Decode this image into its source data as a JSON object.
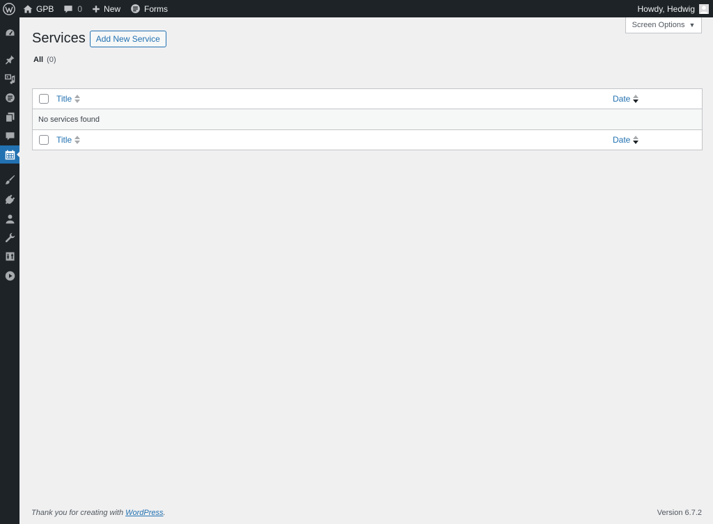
{
  "admin_bar": {
    "site_name": "GPB",
    "comments_count": "0",
    "new_label": "New",
    "forms_label": "Forms",
    "howdy": "Howdy, Hedwig"
  },
  "sidebar": {
    "items": [
      {
        "icon": "dashboard-icon"
      },
      {
        "icon": "posts-pin-icon"
      },
      {
        "icon": "media-icon"
      },
      {
        "icon": "forms-icon"
      },
      {
        "icon": "pages-icon"
      },
      {
        "icon": "comments-icon"
      },
      {
        "icon": "calendar-icon",
        "current": true
      },
      {
        "icon": "appearance-brush-icon"
      },
      {
        "icon": "plugins-icon"
      },
      {
        "icon": "users-icon"
      },
      {
        "icon": "tools-wrench-icon"
      },
      {
        "icon": "settings-icon"
      },
      {
        "icon": "video-play-icon"
      }
    ]
  },
  "header": {
    "title": "Services",
    "add_new_label": "Add New Service",
    "screen_options_label": "Screen Options"
  },
  "filters": {
    "all_label": "All",
    "all_count": "(0)"
  },
  "table": {
    "columns": {
      "title": "Title",
      "date": "Date"
    },
    "empty_message": "No services found"
  },
  "footer": {
    "thanks_prefix": "Thank you for creating with ",
    "wordpress_link": "WordPress",
    "thanks_suffix": ".",
    "version": "Version 6.7.2"
  },
  "colors": {
    "admin_bar_bg": "#1d2327",
    "accent": "#2271b1",
    "page_bg": "#f0f0f1"
  }
}
